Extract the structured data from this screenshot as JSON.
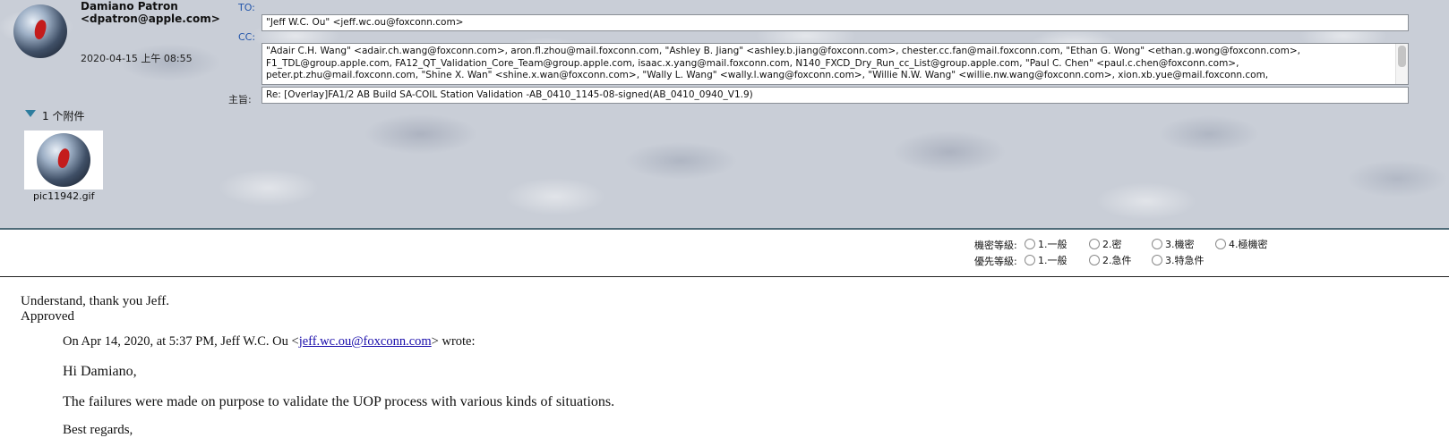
{
  "sender": {
    "name": "Damiano Patron",
    "email": "<dpatron@apple.com>",
    "date": "2020-04-15 上午 08:55"
  },
  "fields": {
    "to_label": "TO:",
    "to_value": "\"Jeff W.C. Ou\" <jeff.wc.ou@foxconn.com>",
    "cc_label": "CC:",
    "cc_lines": [
      "\"Adair C.H. Wang\" <adair.ch.wang@foxconn.com>, aron.fl.zhou@mail.foxconn.com, \"Ashley B. Jiang\" <ashley.b.jiang@foxconn.com>, chester.cc.fan@mail.foxconn.com, \"Ethan G. Wong\" <ethan.g.wong@foxconn.com>,",
      "F1_TDL@group.apple.com, FA12_QT_Validation_Core_Team@group.apple.com, isaac.x.yang@mail.foxconn.com, N140_FXCD_Dry_Run_cc_List@group.apple.com, \"Paul C. Chen\" <paul.c.chen@foxconn.com>,",
      "peter.pt.zhu@mail.foxconn.com, \"Shine X. Wan\" <shine.x.wan@foxconn.com>, \"Wally L. Wang\" <wally.l.wang@foxconn.com>, \"Willie N.W. Wang\" <willie.nw.wang@foxconn.com>, xion.xb.yue@mail.foxconn.com,"
    ],
    "subject_label": "主旨:",
    "subject_value": "Re: [Overlay]FA1/2 AB Build SA-COIL Station Validation -AB_0410_1145-08-signed(AB_0410_0940_V1.9)"
  },
  "attachments": {
    "count_label": "1 个附件",
    "items": [
      {
        "name": "pic11942.gif"
      }
    ]
  },
  "classification": {
    "security_label": "機密等級:",
    "security_options": [
      "1.一般",
      "2.密",
      "3.機密",
      "4.極機密"
    ],
    "priority_label": "優先等級:",
    "priority_options": [
      "1.一般",
      "2.急件",
      "3.特急件"
    ]
  },
  "body": {
    "line1": "Understand, thank you Jeff.",
    "line2": "Approved",
    "quote_prefix": "On Apr 14, 2020, at 5:37 PM, Jeff W.C. Ou <",
    "quote_link": "jeff.wc.ou@foxconn.com",
    "quote_suffix": "> wrote:",
    "greeting": "Hi Damiano,",
    "paragraph": "The failures were made on purpose to validate the UOP process with various kinds of situations.",
    "closing": "Best regards,"
  },
  "colors": {
    "header_bg": "#c9ced7",
    "label_blue": "#2255aa",
    "link_blue": "#1a0dab",
    "toggle_teal": "#2e7d9e"
  },
  "icons": {
    "avatar": "globe-avatar-icon",
    "attachment_toggle": "disclosure-triangle-icon"
  }
}
